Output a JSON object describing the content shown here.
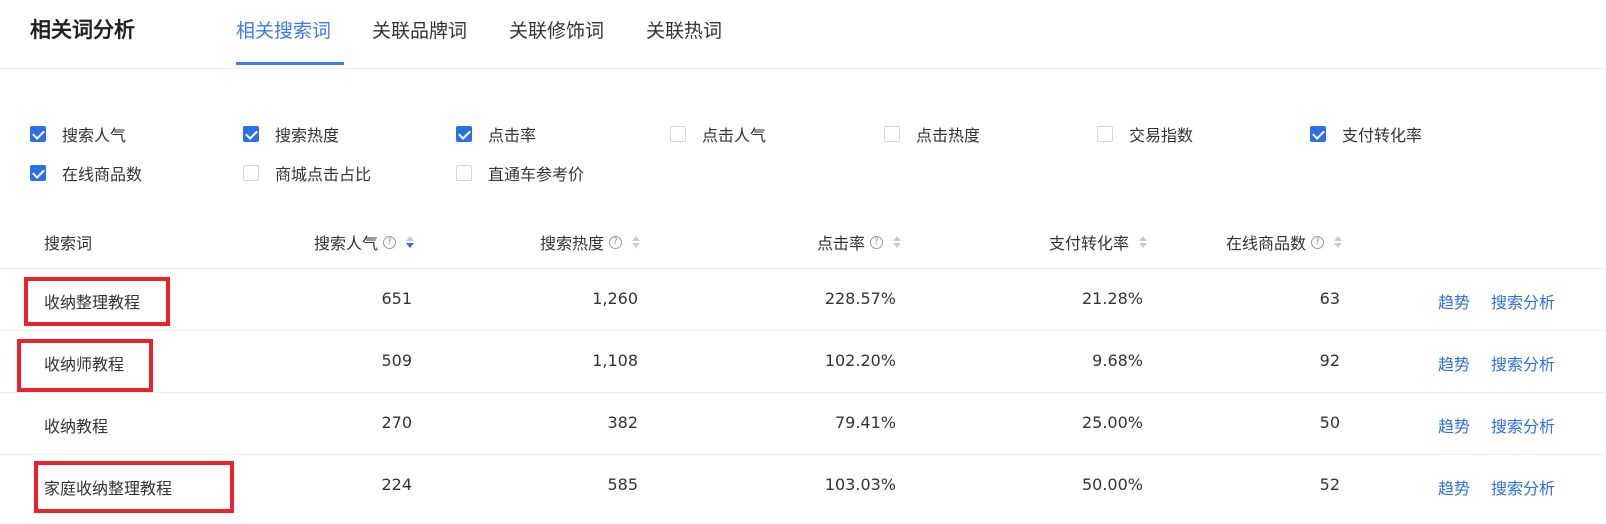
{
  "header": {
    "title": "相关词分析",
    "tabs": [
      {
        "label": "相关搜索词",
        "active": true
      },
      {
        "label": "关联品牌词",
        "active": false
      },
      {
        "label": "关联修饰词",
        "active": false
      },
      {
        "label": "关联热词",
        "active": false
      }
    ]
  },
  "filters": [
    {
      "label": "搜索人气",
      "checked": true
    },
    {
      "label": "搜索热度",
      "checked": true
    },
    {
      "label": "点击率",
      "checked": true
    },
    {
      "label": "点击人气",
      "checked": false
    },
    {
      "label": "点击热度",
      "checked": false
    },
    {
      "label": "交易指数",
      "checked": false
    },
    {
      "label": "支付转化率",
      "checked": true
    },
    {
      "label": "在线商品数",
      "checked": true
    },
    {
      "label": "商城点击占比",
      "checked": false
    },
    {
      "label": "直通车参考价",
      "checked": false
    }
  ],
  "table": {
    "columns": [
      "搜索词",
      "搜索人气",
      "搜索热度",
      "点击率",
      "支付转化率",
      "在线商品数"
    ],
    "help_icon": "?",
    "rows": [
      {
        "keyword": "收纳整理教程",
        "popularity": "651",
        "heat": "1,260",
        "ctr": "228.57%",
        "conversion": "21.28%",
        "products": "63"
      },
      {
        "keyword": "收纳师教程",
        "popularity": "509",
        "heat": "1,108",
        "ctr": "102.20%",
        "conversion": "9.68%",
        "products": "92"
      },
      {
        "keyword": "收纳教程",
        "popularity": "270",
        "heat": "382",
        "ctr": "79.41%",
        "conversion": "25.00%",
        "products": "50"
      },
      {
        "keyword": "家庭收纳整理教程",
        "popularity": "224",
        "heat": "585",
        "ctr": "103.03%",
        "conversion": "50.00%",
        "products": "52"
      }
    ],
    "actions": {
      "trend": "趋势",
      "analysis": "搜索分析"
    }
  },
  "colors": {
    "accent": "#2d6fe8",
    "highlight_box": "#e8232c"
  }
}
